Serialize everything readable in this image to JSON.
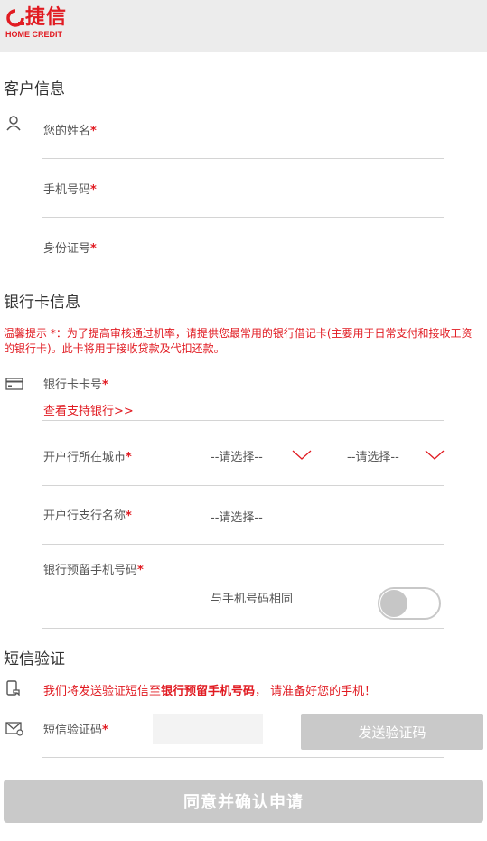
{
  "header": {
    "logo_cn": "捷信",
    "logo_en": "HOME CREDIT"
  },
  "customer": {
    "title": "客户信息",
    "name_label": "您的姓名",
    "phone_label": "手机号码",
    "id_label": "身份证号",
    "required_mark": "*"
  },
  "bank": {
    "title": "银行卡信息",
    "notice": "温馨提示 *：为了提高审核通过机率，请提供您最常用的银行借记卡(主要用于日常支付和接收工资的银行卡)。此卡将用于接收贷款及代扣还款。",
    "card_label": "银行卡卡号",
    "supported_link": "查看支持银行>>",
    "city_label": "开户行所在城市",
    "province_select": "--请选择--",
    "city_select": "--请选择--",
    "branch_label": "开户行支行名称",
    "branch_select": "--请选择--",
    "reserved_phone_label": "银行预留手机号码",
    "same_phone_label": "与手机号码相同",
    "same_phone_on": false
  },
  "sms": {
    "title": "短信验证",
    "note_prefix": "我们将发送验证短信至",
    "note_bold": "银行预留手机号码",
    "note_suffix": "， 请准备好您的手机！",
    "code_label": "短信验证码",
    "send_button": "发送验证码"
  },
  "submit_button": "同意并确认申请",
  "colors": {
    "brand_red": "#e11b22",
    "disabled_gray": "#c9c9c9",
    "header_bg": "#ececec"
  }
}
